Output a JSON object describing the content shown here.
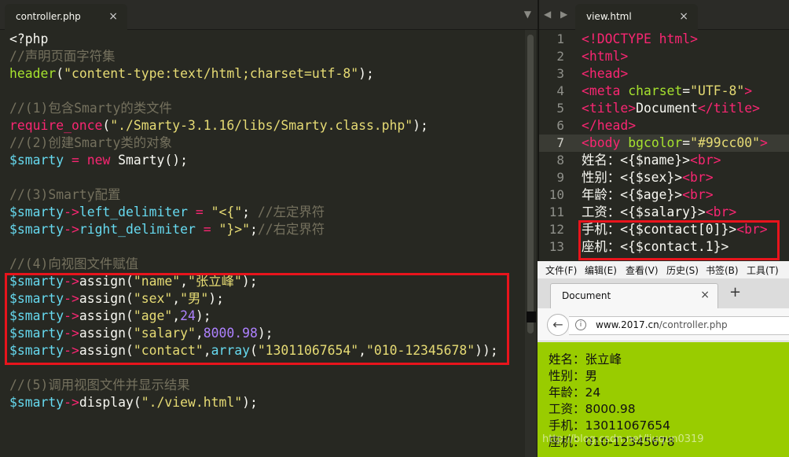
{
  "left_editor": {
    "tab_title": "controller.php",
    "tab_close": "×",
    "dropdown": "▼",
    "lines": [
      [
        {
          "c": "def",
          "t": "<?php"
        }
      ],
      [
        {
          "c": "cm",
          "t": "//声明页面字符集"
        }
      ],
      [
        {
          "c": "fn",
          "t": "header"
        },
        {
          "c": "def",
          "t": "("
        },
        {
          "c": "st",
          "t": "\"content-type:text/html;charset=utf-8\""
        },
        {
          "c": "def",
          "t": ");"
        }
      ],
      [],
      [
        {
          "c": "cm",
          "t": "//(1)包含Smarty的类文件"
        }
      ],
      [
        {
          "c": "kw",
          "t": "require_once"
        },
        {
          "c": "def",
          "t": "("
        },
        {
          "c": "st",
          "t": "\"./Smarty-3.1.16/libs/Smarty.class.php\""
        },
        {
          "c": "def",
          "t": ");"
        }
      ],
      [
        {
          "c": "cm",
          "t": "//(2)创建Smarty类的对象"
        }
      ],
      [
        {
          "c": "var",
          "t": "$smarty"
        },
        {
          "c": "def",
          "t": " "
        },
        {
          "c": "op",
          "t": "="
        },
        {
          "c": "def",
          "t": " "
        },
        {
          "c": "kw",
          "t": "new"
        },
        {
          "c": "def",
          "t": " Smarty();"
        }
      ],
      [],
      [
        {
          "c": "cm",
          "t": "//(3)Smarty配置"
        }
      ],
      [
        {
          "c": "var",
          "t": "$smarty"
        },
        {
          "c": "op",
          "t": "->"
        },
        {
          "c": "var",
          "t": "left_delimiter"
        },
        {
          "c": "def",
          "t": " "
        },
        {
          "c": "op",
          "t": "="
        },
        {
          "c": "def",
          "t": " "
        },
        {
          "c": "st",
          "t": "\"<{\""
        },
        {
          "c": "def",
          "t": "; "
        },
        {
          "c": "cm",
          "t": "//左定界符"
        }
      ],
      [
        {
          "c": "var",
          "t": "$smarty"
        },
        {
          "c": "op",
          "t": "->"
        },
        {
          "c": "var",
          "t": "right_delimiter"
        },
        {
          "c": "def",
          "t": " "
        },
        {
          "c": "op",
          "t": "="
        },
        {
          "c": "def",
          "t": " "
        },
        {
          "c": "st",
          "t": "\"}>\""
        },
        {
          "c": "def",
          "t": ";"
        },
        {
          "c": "cm",
          "t": "//右定界符"
        }
      ],
      [],
      [
        {
          "c": "cm",
          "t": "//(4)向视图文件赋值"
        }
      ],
      [
        {
          "c": "var",
          "t": "$smarty"
        },
        {
          "c": "op",
          "t": "->"
        },
        {
          "c": "def",
          "t": "assign("
        },
        {
          "c": "st",
          "t": "\"name\""
        },
        {
          "c": "def",
          "t": ","
        },
        {
          "c": "st",
          "t": "\"张立峰\""
        },
        {
          "c": "def",
          "t": ");"
        }
      ],
      [
        {
          "c": "var",
          "t": "$smarty"
        },
        {
          "c": "op",
          "t": "->"
        },
        {
          "c": "def",
          "t": "assign("
        },
        {
          "c": "st",
          "t": "\"sex\""
        },
        {
          "c": "def",
          "t": ","
        },
        {
          "c": "st",
          "t": "\"男\""
        },
        {
          "c": "def",
          "t": ");"
        }
      ],
      [
        {
          "c": "var",
          "t": "$smarty"
        },
        {
          "c": "op",
          "t": "->"
        },
        {
          "c": "def",
          "t": "assign("
        },
        {
          "c": "st",
          "t": "\"age\""
        },
        {
          "c": "def",
          "t": ","
        },
        {
          "c": "nm",
          "t": "24"
        },
        {
          "c": "def",
          "t": ");"
        }
      ],
      [
        {
          "c": "var",
          "t": "$smarty"
        },
        {
          "c": "op",
          "t": "->"
        },
        {
          "c": "def",
          "t": "assign("
        },
        {
          "c": "st",
          "t": "\"salary\""
        },
        {
          "c": "def",
          "t": ","
        },
        {
          "c": "nm",
          "t": "8000.98"
        },
        {
          "c": "def",
          "t": ");"
        }
      ],
      [
        {
          "c": "var",
          "t": "$smarty"
        },
        {
          "c": "op",
          "t": "->"
        },
        {
          "c": "def",
          "t": "assign("
        },
        {
          "c": "st",
          "t": "\"contact\""
        },
        {
          "c": "def",
          "t": ","
        },
        {
          "c": "var",
          "t": "array"
        },
        {
          "c": "def",
          "t": "("
        },
        {
          "c": "st",
          "t": "\"13011067654\""
        },
        {
          "c": "def",
          "t": ","
        },
        {
          "c": "st",
          "t": "\"010-12345678\""
        },
        {
          "c": "def",
          "t": "));"
        }
      ],
      [],
      [
        {
          "c": "cm",
          "t": "//(5)调用视图文件并显示结果"
        }
      ],
      [
        {
          "c": "var",
          "t": "$smarty"
        },
        {
          "c": "op",
          "t": "->"
        },
        {
          "c": "def",
          "t": "display("
        },
        {
          "c": "st",
          "t": "\"./view.html\""
        },
        {
          "c": "def",
          "t": ");"
        }
      ]
    ]
  },
  "right_editor": {
    "nav": "◀ ▶",
    "tab_title": "view.html",
    "tab_close": "×",
    "line_numbers": [
      "1",
      "2",
      "3",
      "4",
      "5",
      "6",
      "7",
      "8",
      "9",
      "10",
      "11",
      "12",
      "13"
    ],
    "lines": [
      [
        {
          "c": "tag",
          "t": "<!DOCTYPE html>"
        }
      ],
      [
        {
          "c": "tag",
          "t": "<html>"
        }
      ],
      [
        {
          "c": "tag",
          "t": "<head>"
        }
      ],
      [
        {
          "c": "tag",
          "t": "<meta"
        },
        {
          "c": "def",
          "t": " "
        },
        {
          "c": "attr",
          "t": "charset"
        },
        {
          "c": "def",
          "t": "="
        },
        {
          "c": "st",
          "t": "\"UTF-8\""
        },
        {
          "c": "tag",
          "t": ">"
        }
      ],
      [
        {
          "c": "tag",
          "t": "<title>"
        },
        {
          "c": "def",
          "t": "Document"
        },
        {
          "c": "tag",
          "t": "</title>"
        }
      ],
      [
        {
          "c": "tag",
          "t": "</head>"
        }
      ],
      [
        {
          "c": "tag",
          "t": "<body"
        },
        {
          "c": "def",
          "t": " "
        },
        {
          "c": "attr",
          "t": "bgcolor"
        },
        {
          "c": "def",
          "t": "="
        },
        {
          "c": "st",
          "t": "\"#99cc00\""
        },
        {
          "c": "tag",
          "t": ">"
        }
      ],
      [
        {
          "c": "def",
          "t": "姓名：<{$name}>"
        },
        {
          "c": "tag",
          "t": "<br>"
        }
      ],
      [
        {
          "c": "def",
          "t": "性别：<{$sex}>"
        },
        {
          "c": "tag",
          "t": "<br>"
        }
      ],
      [
        {
          "c": "def",
          "t": "年龄：<{$age}>"
        },
        {
          "c": "tag",
          "t": "<br>"
        }
      ],
      [
        {
          "c": "def",
          "t": "工资：<{$salary}>"
        },
        {
          "c": "tag",
          "t": "<br>"
        }
      ],
      [
        {
          "c": "def",
          "t": "手机：<{$contact[0]}>"
        },
        {
          "c": "tag",
          "t": "<br>"
        }
      ],
      [
        {
          "c": "def",
          "t": "座机：<{$contact.1}>"
        }
      ]
    ]
  },
  "browser": {
    "menu": [
      "文件(F)",
      "编辑(E)",
      "查看(V)",
      "历史(S)",
      "书签(B)",
      "工具(T)"
    ],
    "tab_title": "Document",
    "tab_close": "×",
    "new_tab": "+",
    "back": "←",
    "info": "i",
    "url_host": "www.2017.cn",
    "url_path": "/controller.php",
    "page_lines": [
      "姓名：张立峰",
      "性别：男",
      "年龄：24",
      "工资：8000.98",
      "手机：13011067654",
      "座机：010-12345678"
    ]
  },
  "watermark": "http://blog.csdn.net/liuqun0319",
  "colors": {
    "editor_bg": "#272822",
    "highlight_box": "#e8141c",
    "page_bg": "#99cc00"
  }
}
